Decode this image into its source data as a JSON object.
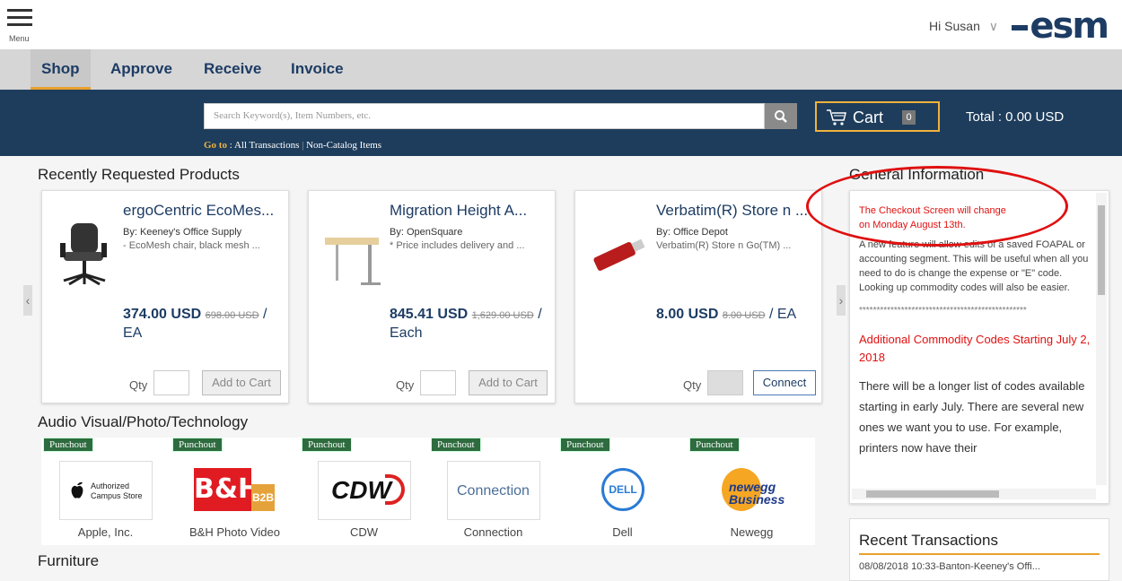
{
  "header": {
    "menu_label": "Menu",
    "greeting": "Hi Susan",
    "logo": "esm",
    "caret": "∨"
  },
  "nav": {
    "tabs": [
      "Shop",
      "Approve",
      "Receive",
      "Invoice"
    ],
    "active": "Shop"
  },
  "search": {
    "placeholder": "Search Keyword(s), Item Numbers, etc.",
    "goto_label": "Go to",
    "goto_links": [
      "All Transactions",
      "Non-Catalog Items"
    ]
  },
  "cart": {
    "label": "Cart",
    "count": "0",
    "total": "Total : 0.00 USD"
  },
  "recent_products": {
    "title": "Recently Requested Products",
    "items": [
      {
        "name": "ergoCentric EcoMes...",
        "by": "By: Keeney's Office Supply",
        "desc": "- EcoMesh chair, black mesh ...",
        "price": "374.00 USD",
        "old_price": "698.00 USD",
        "unit": "/ EA",
        "qty_label": "Qty",
        "button": "Add to Cart",
        "icon": "office-chair-icon"
      },
      {
        "name": "Migration Height A...",
        "by": "By: OpenSquare",
        "desc": "* Price includes delivery and ...",
        "price": "845.41 USD",
        "old_price": "1,629.00 USD",
        "unit": "/ Each",
        "qty_label": "Qty",
        "button": "Add to Cart",
        "icon": "standing-desk-icon"
      },
      {
        "name": "Verbatim(R) Store n ...",
        "by": "By: Office Depot",
        "desc": "Verbatim(R) Store n Go(TM) ...",
        "price": "8.00 USD",
        "old_price": "8.00 USD",
        "unit": "/ EA",
        "qty_label": "Qty",
        "button": "Connect",
        "icon": "usb-drive-icon"
      }
    ]
  },
  "av": {
    "title": "Audio Visual/Photo/Technology",
    "badge": "Punchout",
    "vendors": [
      {
        "name": "Apple, Inc.",
        "logo_text": "Authorized Campus Store"
      },
      {
        "name": "B&H Photo Video",
        "logo_text": "B&H"
      },
      {
        "name": "CDW",
        "logo_text": "CDW"
      },
      {
        "name": "Connection",
        "logo_text": "Connection"
      },
      {
        "name": "Dell",
        "logo_text": "DELL"
      },
      {
        "name": "Newegg",
        "logo_text": "newegg Business"
      }
    ]
  },
  "furniture_title": "Furniture",
  "general_info": {
    "title": "General Information",
    "alert_line1": "The Checkout Screen will change",
    "alert_line2": "on Monday August 13th.",
    "para": "A new feature will allow edits of a saved FOAPAL or accounting segment.  This will be useful when all you need to do is change the expense or \"E\" code.   Looking up commodity codes will also be easier.",
    "stars": "************************************************",
    "heading2": "Additional Commodity Codes Starting July 2, 2018",
    "body2": "There will be a longer list of codes available starting in early July.  There are several new ones we want you to use. For example, printers now have their"
  },
  "recent_transactions": {
    "title": "Recent Transactions",
    "row": "08/08/2018 10:33-Banton-Keeney's Offi..."
  },
  "colors": {
    "navy": "#1e3d5c",
    "accent": "#f0b23c",
    "alert": "#e01010",
    "punchout": "#2e6b3e"
  }
}
